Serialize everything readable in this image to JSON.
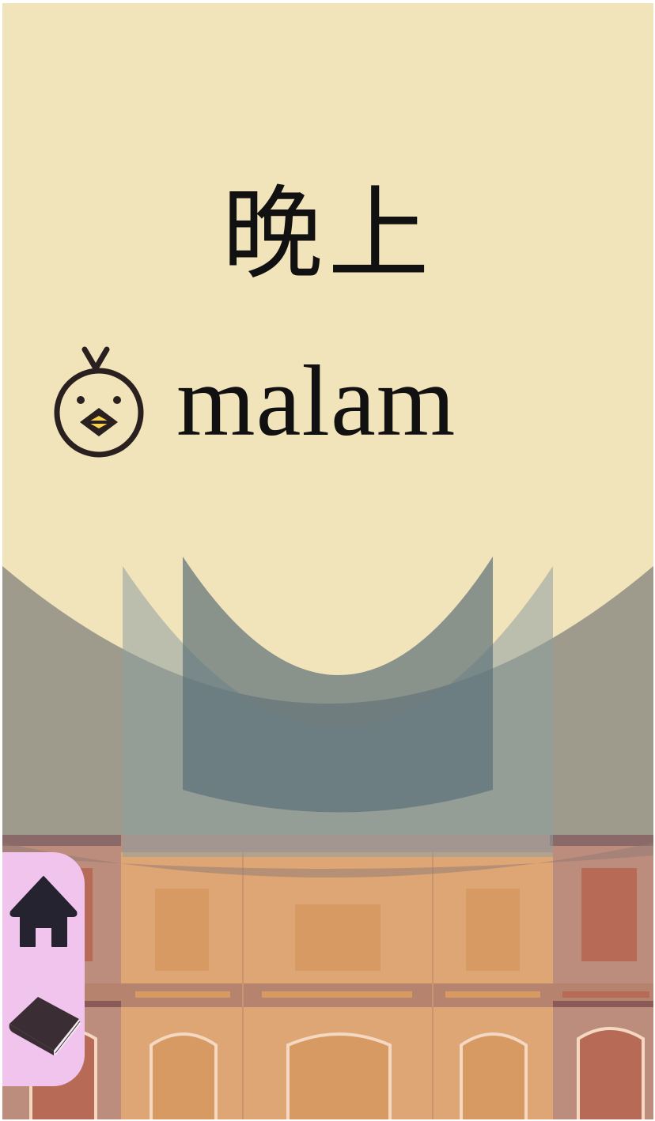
{
  "word": {
    "chinese": "晚上",
    "malay": "malam"
  },
  "icons": {
    "mascot": "chick-face-icon",
    "home": "home-icon",
    "book": "book-icon"
  },
  "colors": {
    "background": "#f1e4ba",
    "nav_panel": "#f0c4ec",
    "nav_icon": "#25232f",
    "mascot_stroke": "#2a2020",
    "mascot_beak": "#f5d34d"
  }
}
